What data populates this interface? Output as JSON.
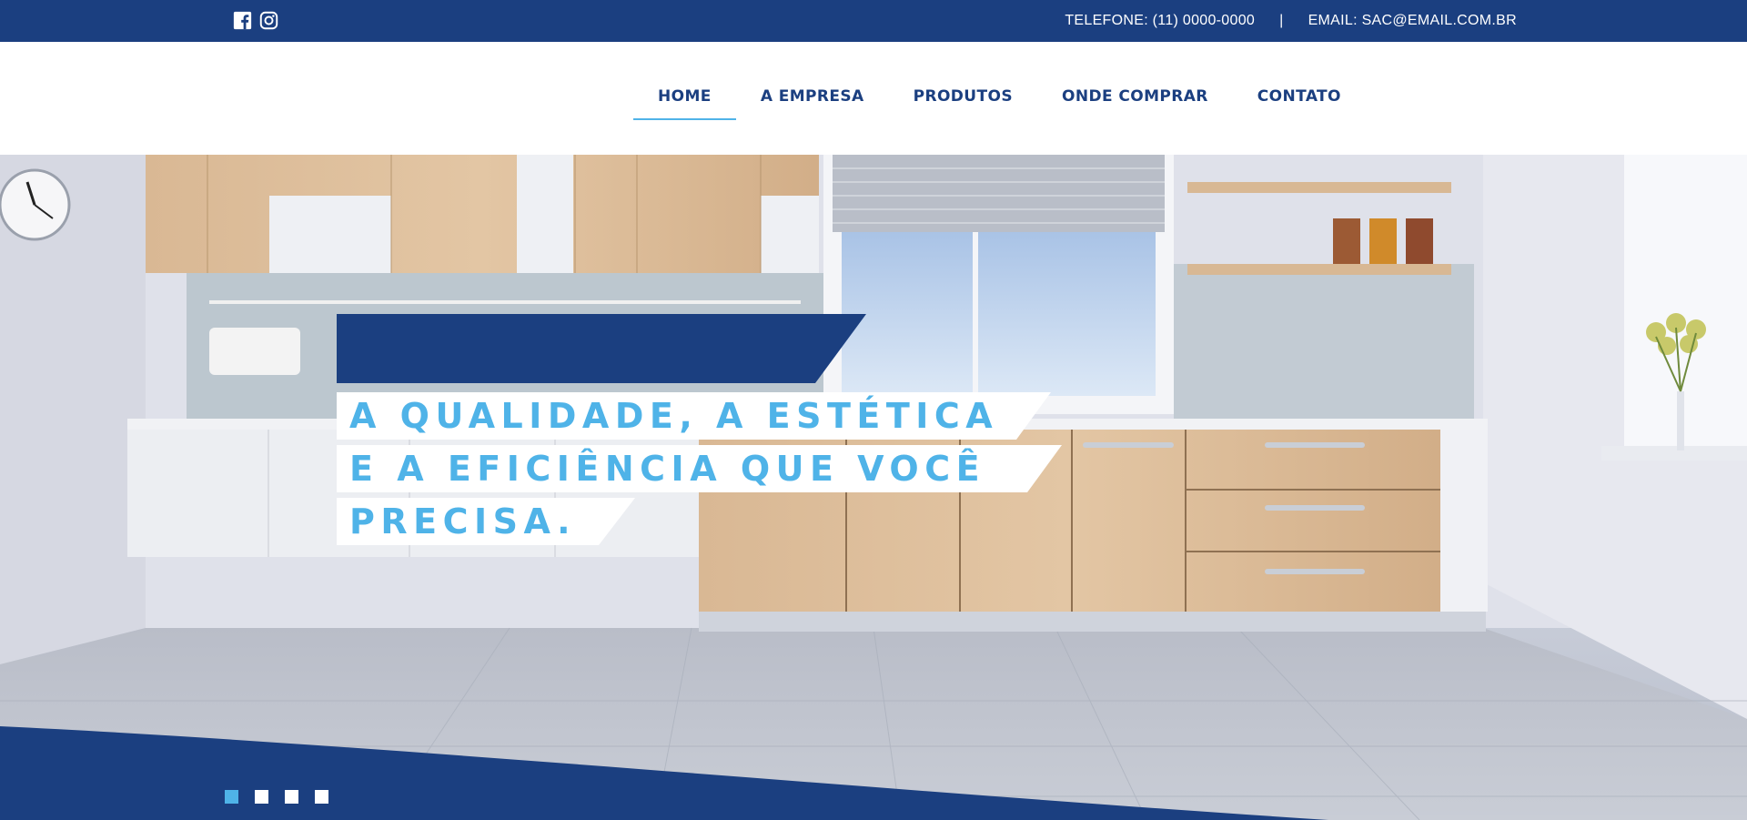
{
  "topbar": {
    "social": [
      {
        "icon": "facebook-icon"
      },
      {
        "icon": "instagram-icon"
      }
    ],
    "phone": "TELEFONE: (11) 0000-0000",
    "separator": "|",
    "email": "EMAIL: SAC@EMAIL.COM.BR"
  },
  "nav": {
    "items": [
      {
        "label": "HOME",
        "active": true
      },
      {
        "label": "A EMPRESA",
        "active": false
      },
      {
        "label": "PRODUTOS",
        "active": false
      },
      {
        "label": "ONDE COMPRAR",
        "active": false
      },
      {
        "label": "CONTATO",
        "active": false
      }
    ]
  },
  "hero": {
    "headline_lines": [
      "A QUALIDADE, A ESTÉTICA",
      "E A EFICIÊNCIA QUE VOCÊ",
      "PRECISA."
    ],
    "slides": {
      "count": 4,
      "active": 1
    }
  },
  "colors": {
    "brand_blue": "#1b3f80",
    "accent_light_blue": "#4fb3e8",
    "white": "#ffffff"
  }
}
